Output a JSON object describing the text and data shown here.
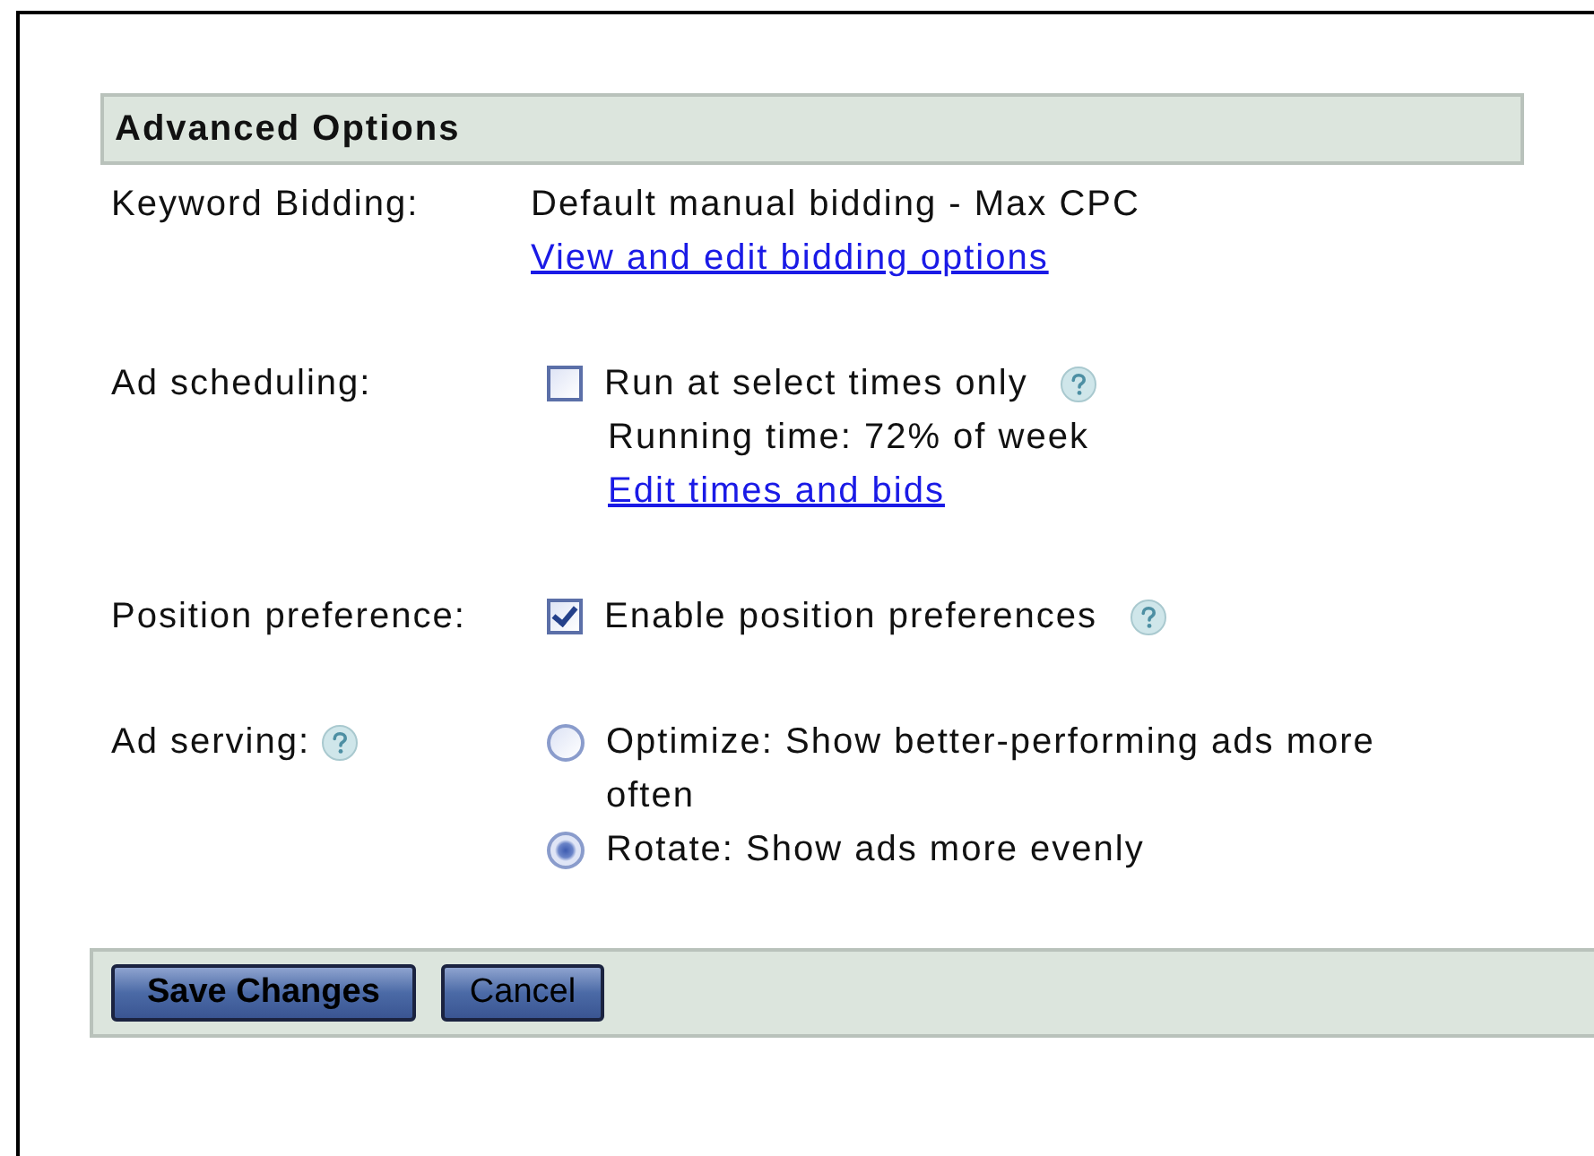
{
  "section": {
    "title": "Advanced Options"
  },
  "rows": [
    {
      "kind": "text",
      "label": "Keyword Bidding:",
      "value": "Default manual bidding - Max CPC",
      "link": "View and edit bidding options"
    },
    {
      "kind": "checkbox",
      "label": "Ad scheduling:",
      "option": "Run at select times only",
      "checked": false,
      "help": true,
      "note": "Running time: 72% of week",
      "link": "Edit times and bids"
    },
    {
      "kind": "checkbox",
      "label": "Position preference:",
      "option": "Enable position preferences",
      "checked": true,
      "help": true
    },
    {
      "kind": "radio",
      "label": "Ad serving:",
      "label_help": true,
      "options": [
        {
          "label": "Optimize: Show better-performing ads more often",
          "selected": false
        },
        {
          "label": "Rotate: Show ads more evenly",
          "selected": true
        }
      ]
    }
  ],
  "buttons": [
    {
      "label": "Save Changes",
      "primary": true
    },
    {
      "label": "Cancel",
      "primary": false
    }
  ]
}
